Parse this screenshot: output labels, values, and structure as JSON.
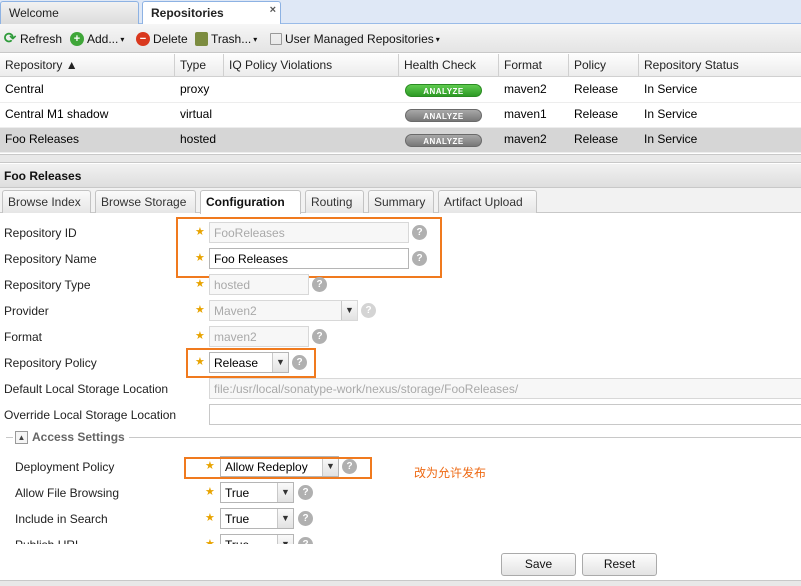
{
  "tabs": [
    {
      "label": "Welcome"
    },
    {
      "label": "Repositories",
      "close": "×"
    }
  ],
  "toolbar": {
    "refresh": "Refresh",
    "add": "Add...",
    "delete": "Delete",
    "trash": "Trash...",
    "user_managed": "User Managed Repositories"
  },
  "grid": {
    "columns": [
      "Repository ▲",
      "Type",
      "IQ Policy Violations",
      "Health Check",
      "Format",
      "Policy",
      "Repository Status"
    ],
    "rows": [
      {
        "repository": "Central",
        "type": "proxy",
        "violations": "",
        "health": "ANALYZE",
        "format": "maven2",
        "policy": "Release",
        "status": "In Service"
      },
      {
        "repository": "Central M1 shadow",
        "type": "virtual",
        "violations": "",
        "health": "ANALYZE",
        "format": "maven1",
        "policy": "Release",
        "status": "In Service"
      },
      {
        "repository": "Foo Releases",
        "type": "hosted",
        "violations": "",
        "health": "ANALYZE",
        "format": "maven2",
        "policy": "Release",
        "status": "In Service"
      }
    ]
  },
  "panel": {
    "title": "Foo Releases",
    "tabs": [
      "Browse Index",
      "Browse Storage",
      "Configuration",
      "Routing",
      "Summary",
      "Artifact Upload"
    ]
  },
  "form": {
    "repo_id": {
      "label": "Repository ID",
      "value": "FooReleases"
    },
    "repo_name": {
      "label": "Repository Name",
      "value": "Foo Releases"
    },
    "repo_type": {
      "label": "Repository Type",
      "value": "hosted"
    },
    "provider": {
      "label": "Provider",
      "value": "Maven2"
    },
    "format": {
      "label": "Format",
      "value": "maven2"
    },
    "repo_policy": {
      "label": "Repository Policy",
      "value": "Release"
    },
    "default_storage": {
      "label": "Default Local Storage Location",
      "value": "file:/usr/local/sonatype-work/nexus/storage/FooReleases/"
    },
    "override_storage": {
      "label": "Override Local Storage Location",
      "value": ""
    },
    "access_settings": "Access Settings",
    "deployment_policy": {
      "label": "Deployment Policy",
      "value": "Allow Redeploy"
    },
    "allow_browsing": {
      "label": "Allow File Browsing",
      "value": "True"
    },
    "include_search": {
      "label": "Include in Search",
      "value": "True"
    },
    "publish_url": {
      "label": "Publish URL",
      "value": "True"
    },
    "annotation": "改为允许发布",
    "save": "Save",
    "reset": "Reset"
  },
  "icons": {
    "star": "★",
    "help": "?",
    "dropdown": "▼",
    "caret": "▾",
    "collapse": "▲"
  }
}
